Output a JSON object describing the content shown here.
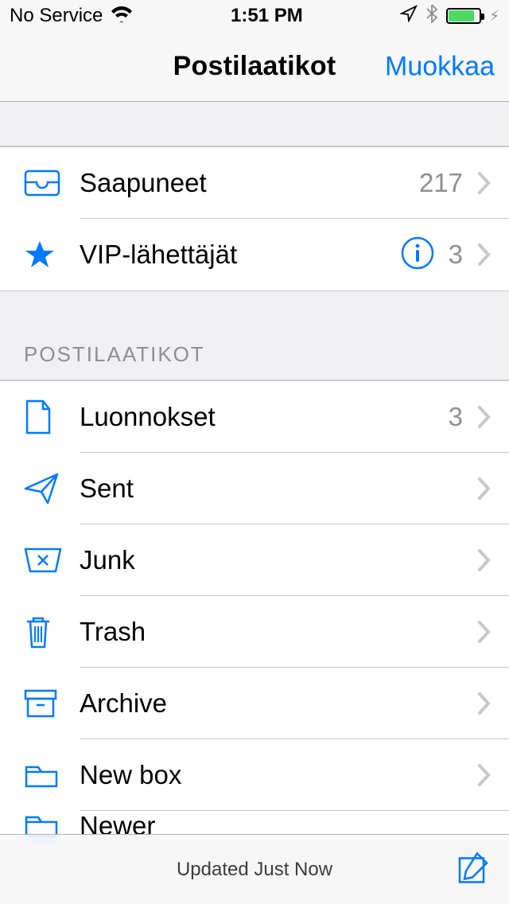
{
  "status": {
    "carrier": "No Service",
    "time": "1:51 PM"
  },
  "nav": {
    "title": "Postilaatikot",
    "edit": "Muokkaa"
  },
  "top_rows": [
    {
      "icon": "inbox",
      "label": "Saapuneet",
      "count": "217",
      "info": false
    },
    {
      "icon": "star",
      "label": "VIP-lähettäjät",
      "count": "3",
      "info": true
    }
  ],
  "section_header": "POSTILAATIKOT",
  "mailboxes": [
    {
      "icon": "doc",
      "label": "Luonnokset",
      "count": "3"
    },
    {
      "icon": "send",
      "label": "Sent"
    },
    {
      "icon": "junk",
      "label": "Junk"
    },
    {
      "icon": "trash",
      "label": "Trash"
    },
    {
      "icon": "archive",
      "label": "Archive"
    },
    {
      "icon": "folder",
      "label": "New box"
    }
  ],
  "peek_row": {
    "icon": "folder",
    "label": "Newer"
  },
  "toolbar": {
    "status": "Updated Just Now"
  }
}
